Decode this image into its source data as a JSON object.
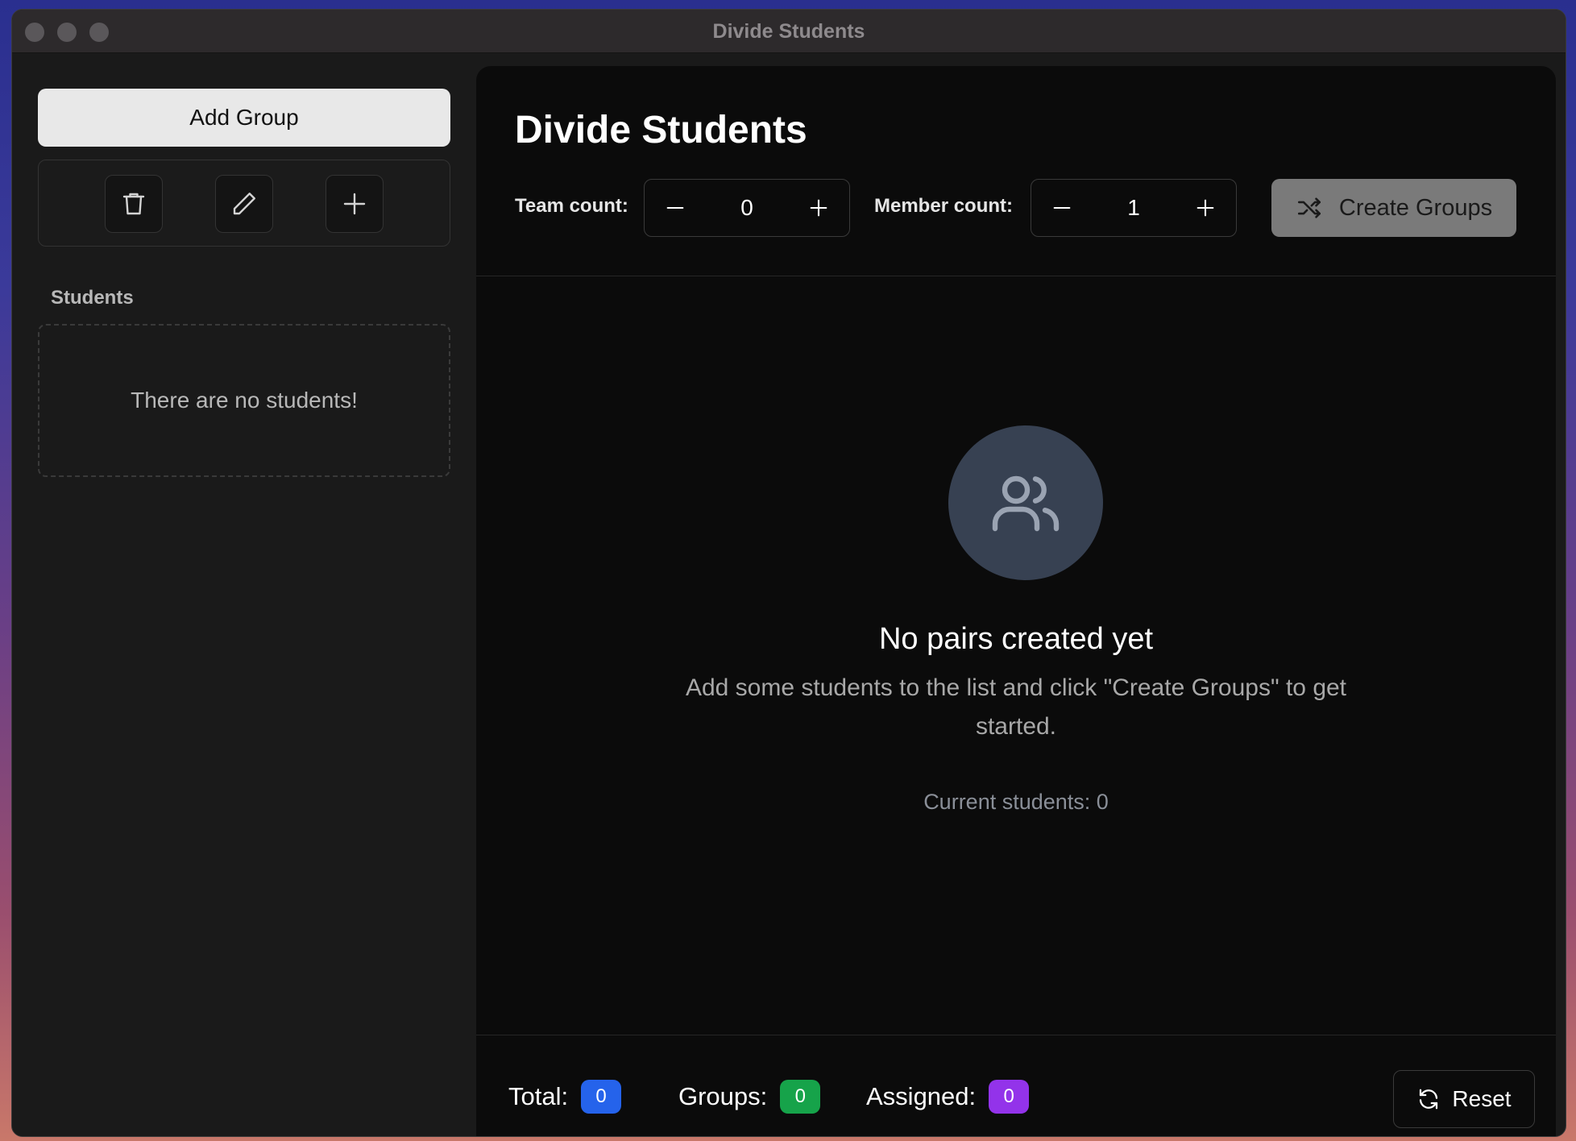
{
  "window": {
    "title": "Divide Students"
  },
  "sidebar": {
    "add_group_label": "Add Group",
    "toolbar_icons": [
      "trash-icon",
      "pencil-icon",
      "plus-icon"
    ],
    "students_heading": "Students",
    "students_empty": "There are no students!"
  },
  "main": {
    "title": "Divide Students",
    "team_count_label": "Team count:",
    "team_count_value": "0",
    "member_count_label": "Member count:",
    "member_count_value": "1",
    "create_groups_label": "Create Groups",
    "empty_state": {
      "title": "No pairs created yet",
      "description": "Add some students to the list and click \"Create Groups\" to get started.",
      "current_students": "Current students: 0"
    }
  },
  "footer": {
    "total_label": "Total:",
    "total_value": "0",
    "groups_label": "Groups:",
    "groups_value": "0",
    "assigned_label": "Assigned:",
    "assigned_value": "0",
    "reset_label": "Reset"
  },
  "colors": {
    "total_badge": "#2563eb",
    "groups_badge": "#16a34a",
    "assigned_badge": "#9333ea",
    "empty_circle": "#374152"
  }
}
